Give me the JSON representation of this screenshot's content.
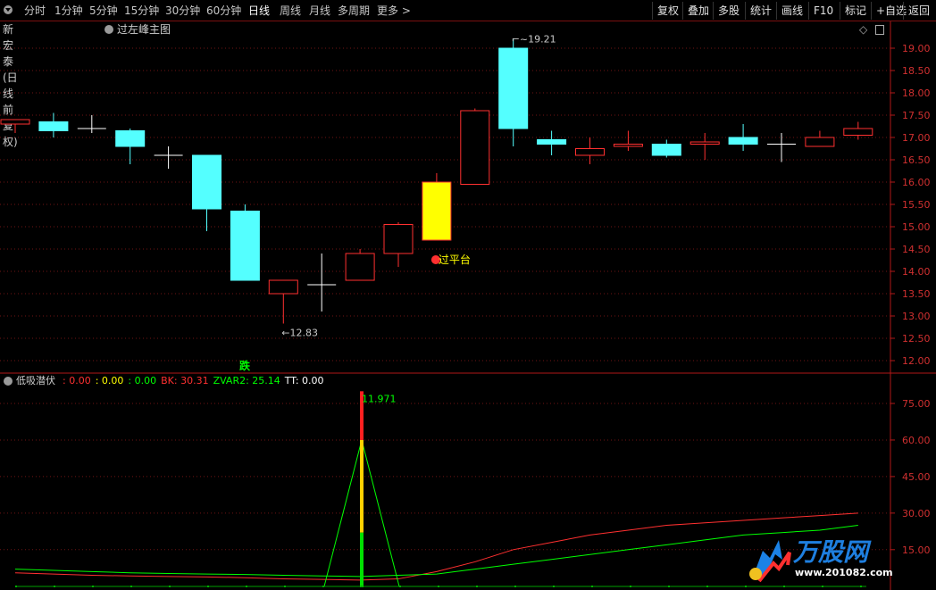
{
  "toolbar": {
    "left_items": [
      "分时",
      "1分钟",
      "5分钟",
      "15分钟",
      "30分钟",
      "60分钟",
      "日线",
      "周线",
      "月线",
      "多周期",
      "更多 >"
    ],
    "active_item": "日线",
    "right_items": [
      "复权",
      "叠加",
      "多股",
      "统计",
      "画线",
      "F10",
      "标记",
      "+自选",
      "返回"
    ]
  },
  "main_chart": {
    "stock_title": "新宏泰(日线 前复权)",
    "formula_name": "过左峰主图",
    "y_ticks": [
      "19.00",
      "18.50",
      "18.00",
      "17.50",
      "17.00",
      "16.50",
      "16.00",
      "15.50",
      "15.00",
      "14.50",
      "14.00",
      "13.50",
      "13.00",
      "12.50",
      "12.00"
    ],
    "high_label": "19.21",
    "low_label": "12.83",
    "signal_label": "过平台",
    "down_label": "跌",
    "colors": {
      "up": "#ff3030",
      "down": "#54ffff",
      "doji": "#ffffff",
      "signal_fill": "#ffff00",
      "grid": "#8b1a1a"
    },
    "candles": [
      {
        "o": 17.3,
        "h": 17.4,
        "l": 17.1,
        "c": 17.4
      },
      {
        "o": 17.35,
        "h": 17.55,
        "l": 17.0,
        "c": 17.15
      },
      {
        "o": 17.2,
        "h": 17.5,
        "l": 17.1,
        "c": 17.2
      },
      {
        "o": 17.15,
        "h": 17.2,
        "l": 16.4,
        "c": 16.8
      },
      {
        "o": 16.6,
        "h": 16.8,
        "l": 16.3,
        "c": 16.6
      },
      {
        "o": 16.6,
        "h": 16.6,
        "l": 14.9,
        "c": 15.4
      },
      {
        "o": 15.35,
        "h": 15.5,
        "l": 13.8,
        "c": 13.8
      },
      {
        "o": 13.5,
        "h": 13.75,
        "l": 12.83,
        "c": 13.8
      },
      {
        "o": 13.7,
        "h": 14.4,
        "l": 13.1,
        "c": 13.7
      },
      {
        "o": 13.8,
        "h": 14.5,
        "l": 13.8,
        "c": 14.4
      },
      {
        "o": 14.4,
        "h": 15.1,
        "l": 14.1,
        "c": 15.05
      },
      {
        "o": 14.7,
        "h": 16.2,
        "l": 14.7,
        "c": 16.0,
        "signal": true
      },
      {
        "o": 15.95,
        "h": 17.65,
        "l": 15.95,
        "c": 17.6
      },
      {
        "o": 19.0,
        "h": 19.21,
        "l": 16.8,
        "c": 17.2
      },
      {
        "o": 16.95,
        "h": 17.15,
        "l": 16.6,
        "c": 16.85
      },
      {
        "o": 16.6,
        "h": 17.0,
        "l": 16.4,
        "c": 16.75
      },
      {
        "o": 16.8,
        "h": 17.15,
        "l": 16.7,
        "c": 16.85
      },
      {
        "o": 16.85,
        "h": 16.95,
        "l": 16.55,
        "c": 16.6
      },
      {
        "o": 16.85,
        "h": 17.1,
        "l": 16.5,
        "c": 16.9
      },
      {
        "o": 17.0,
        "h": 17.3,
        "l": 16.7,
        "c": 16.85
      },
      {
        "o": 16.85,
        "h": 17.1,
        "l": 16.45,
        "c": 16.85
      },
      {
        "o": 16.8,
        "h": 17.15,
        "l": 16.8,
        "c": 17.0
      },
      {
        "o": 17.05,
        "h": 17.35,
        "l": 16.95,
        "c": 17.2
      }
    ]
  },
  "indicator": {
    "name": "低吸潜伏",
    "values": [
      {
        "text": ": 0.00",
        "color": "#ff3030"
      },
      {
        "text": ": 0.00",
        "color": "#ffff00"
      },
      {
        "text": ": 0.00",
        "color": "#00ff00"
      },
      {
        "text": "BK: 30.31",
        "color": "#ff3030"
      },
      {
        "text": "ZVAR2: 25.14",
        "color": "#00ff00"
      },
      {
        "text": "TT: 0.00",
        "color": "#ffffff"
      }
    ],
    "y_ticks": [
      "75.00",
      "60.00",
      "45.00",
      "30.00",
      "15.00"
    ],
    "peak_label": "11.971",
    "red_line": [
      5.5,
      5,
      4.5,
      4.2,
      4,
      3.8,
      3.5,
      3,
      2.8,
      2.5,
      3,
      6,
      10,
      15,
      18,
      21,
      23,
      25,
      26,
      27,
      28,
      29,
      30
    ],
    "green_line": [
      7,
      6.5,
      6,
      5.5,
      5.2,
      5,
      4.8,
      4.5,
      4.2,
      4,
      4.5,
      5,
      7,
      9,
      11,
      13,
      15,
      17,
      19,
      21,
      22,
      23,
      25
    ],
    "green_peak": 60,
    "spike_bar": {
      "index": 9.5,
      "top": 80,
      "mid_red_to": 60,
      "yellow_to": 22
    }
  },
  "watermark": {
    "brand": "万股网",
    "url": "www.201082.com"
  }
}
